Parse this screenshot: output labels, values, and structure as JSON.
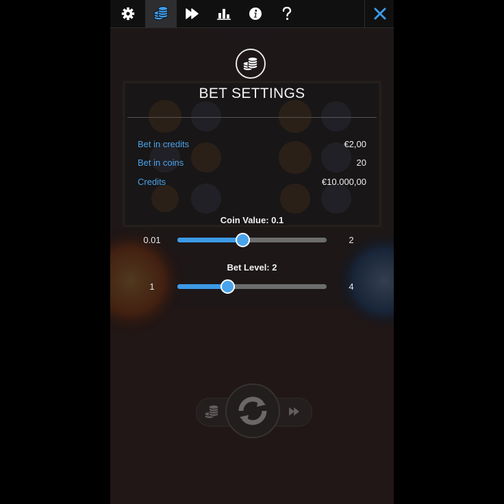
{
  "tabs": [
    {
      "icon": "gear-icon",
      "active": false
    },
    {
      "icon": "coins-icon",
      "active": true
    },
    {
      "icon": "fast-forward-icon",
      "active": false
    },
    {
      "icon": "bar-chart-icon",
      "active": false
    },
    {
      "icon": "info-icon",
      "active": false
    },
    {
      "icon": "question-icon",
      "active": false
    },
    {
      "icon": "close-icon",
      "active": false
    }
  ],
  "header": {
    "title": "BET SETTINGS",
    "icon": "coins-icon"
  },
  "info": {
    "rows": [
      {
        "label": "Bet in credits",
        "value": "€2,00"
      },
      {
        "label": "Bet in coins",
        "value": "20"
      },
      {
        "label": "Credits",
        "value": "€10.000,00"
      }
    ]
  },
  "coin_value": {
    "title": "Coin Value: 0.1",
    "min_label": "0.01",
    "max_label": "2",
    "fraction": 0.43
  },
  "bet_level": {
    "title": "Bet Level: 2",
    "min_label": "1",
    "max_label": "4",
    "fraction": 0.33
  },
  "bottom_controls": {
    "icons": [
      "coins-icon",
      "spin-icon",
      "fast-forward-icon"
    ]
  },
  "colors": {
    "accent": "#4aa3ea",
    "close": "#3d9ae6",
    "panel": "#1a1718"
  }
}
